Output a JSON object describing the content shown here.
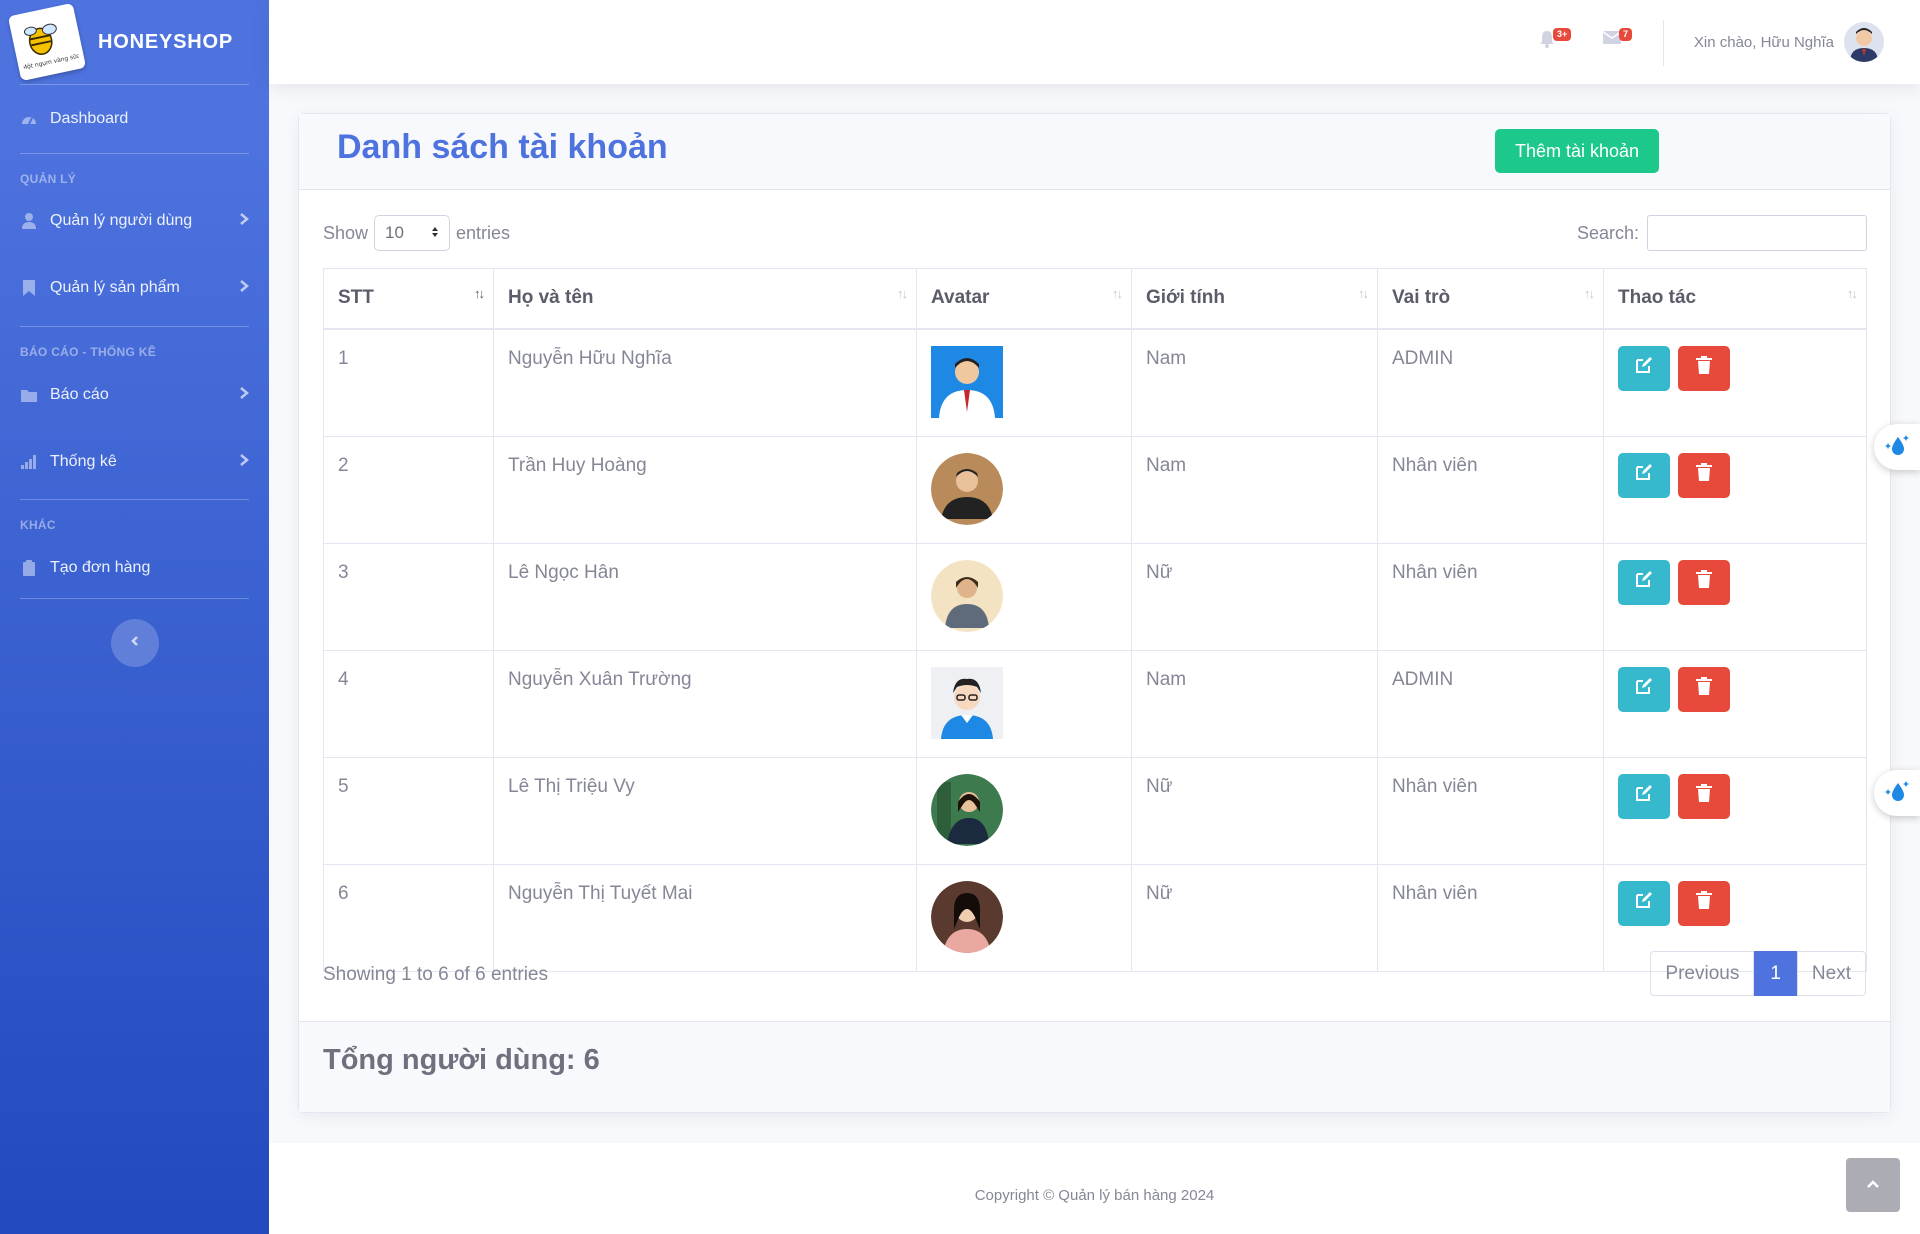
{
  "brand": {
    "name": "HONEYSHOP",
    "logo_caption": "Một ngụm vàng sữa"
  },
  "sidebar": {
    "dashboard": "Dashboard",
    "heading_manage": "QUẢN LÝ",
    "users": "Quản lý người dùng",
    "products": "Quản lý sản phẩm",
    "heading_reports": "BÁO CÁO - THỐNG KÊ",
    "reports": "Báo cáo",
    "statistics": "Thống kê",
    "heading_other": "KHÁC",
    "create_order": "Tạo đơn hàng"
  },
  "topbar": {
    "alerts_badge": "3+",
    "messages_badge": "7",
    "greeting": "Xin chào, Hữu Nghĩa"
  },
  "page": {
    "title": "Danh sách tài khoản",
    "add_button": "Thêm tài khoản",
    "show_label": "Show",
    "entries_label": "entries",
    "page_size": "10",
    "search_label": "Search:",
    "search_value": ""
  },
  "table": {
    "headers": [
      "STT",
      "Họ và tên",
      "Avatar",
      "Giới tính",
      "Vai trò",
      "Thao tác"
    ],
    "rows": [
      {
        "stt": "1",
        "name": "Nguyễn Hữu Nghĩa",
        "gender": "Nam",
        "role": "ADMIN"
      },
      {
        "stt": "2",
        "name": "Trần Huy Hoàng",
        "gender": "Nam",
        "role": "Nhân viên"
      },
      {
        "stt": "3",
        "name": "Lê Ngọc Hân",
        "gender": "Nữ",
        "role": "Nhân viên"
      },
      {
        "stt": "4",
        "name": "Nguyễn Xuân Trường",
        "gender": "Nam",
        "role": "ADMIN"
      },
      {
        "stt": "5",
        "name": "Lê Thị Triệu Vy",
        "gender": "Nữ",
        "role": "Nhân viên"
      },
      {
        "stt": "6",
        "name": "Nguyễn Thị Tuyết Mai",
        "gender": "Nữ",
        "role": "Nhân viên"
      }
    ]
  },
  "pagination": {
    "info": "Showing 1 to 6 of 6 entries",
    "previous": "Previous",
    "current": "1",
    "next": "Next"
  },
  "summary": {
    "total": "Tổng người dùng: 6"
  },
  "footer": {
    "copyright": "Copyright © Quản lý bán hàng 2024"
  },
  "colors": {
    "primary": "#4e73df",
    "success": "#1cc88a",
    "info": "#36b9cc",
    "danger": "#e74a3b"
  },
  "icons": [
    "tachometer-icon",
    "user-icon",
    "bookmark-icon",
    "folder-icon",
    "bar-chart-icon",
    "clipboard-icon",
    "bell-icon",
    "envelope-icon",
    "edit-icon",
    "trash-icon",
    "chevron-right-icon",
    "chevron-left-icon",
    "chevron-up-icon",
    "sparkle-drop-icon"
  ]
}
